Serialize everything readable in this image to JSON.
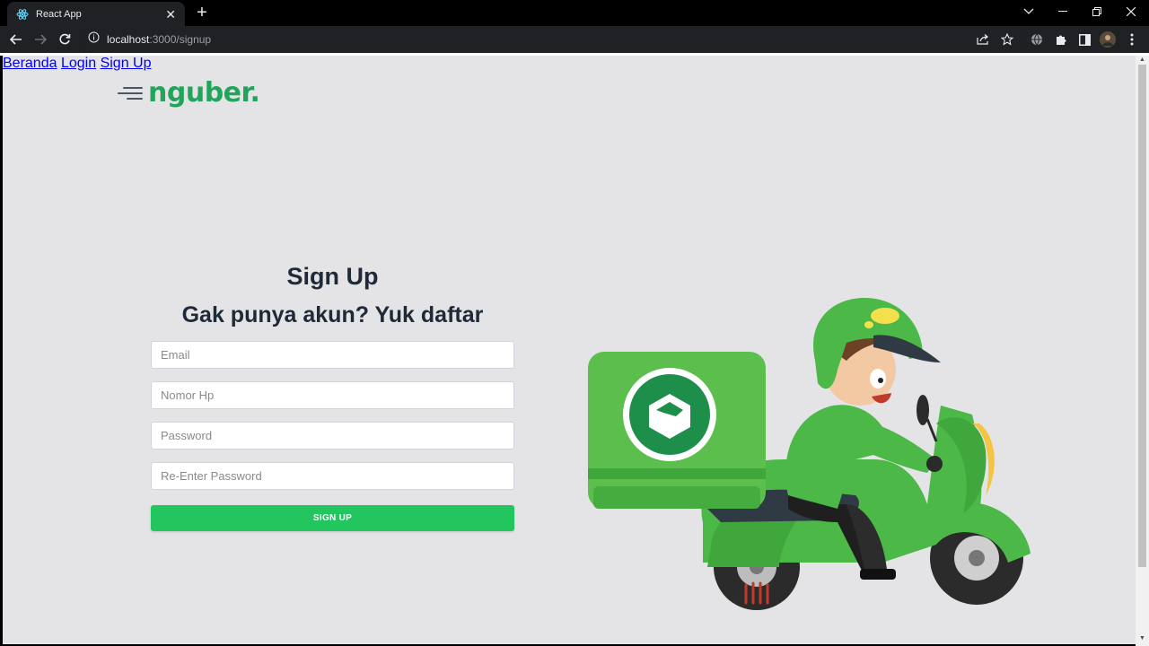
{
  "browser": {
    "tab_title": "React App",
    "url_host": "localhost",
    "url_path": ":3000/signup"
  },
  "header": {
    "logo_text": "nguber.",
    "nav": [
      "Beranda",
      "Login",
      "Sign Up"
    ]
  },
  "form": {
    "title": "Sign Up",
    "subtitle": "Gak punya akun? Yuk daftar",
    "fields": [
      {
        "placeholder": "Email",
        "value": ""
      },
      {
        "placeholder": "Nomor Hp",
        "value": ""
      },
      {
        "placeholder": "Password",
        "value": ""
      },
      {
        "placeholder": "Re-Enter Password",
        "value": ""
      }
    ],
    "submit_label": "SIGN UP"
  },
  "illustration": {
    "icon": "delivery-scooter-illustration",
    "colors": {
      "primary": "#4cb847",
      "dark": "#2e8b37",
      "accent": "#22c55e"
    }
  },
  "colors": {
    "brand": "#22a55a",
    "button": "#22c55e",
    "page_bg": "#e4e4e7"
  }
}
